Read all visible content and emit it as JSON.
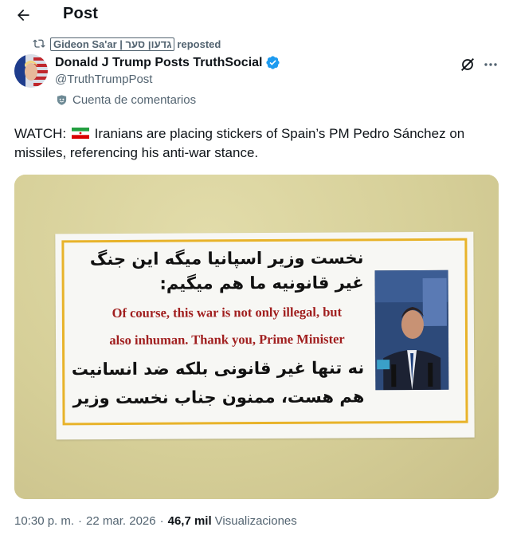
{
  "header": {
    "title": "Post"
  },
  "repost": {
    "reposter": "Gideon Sa'ar | גדעון סער",
    "suffix": "reposted"
  },
  "author": {
    "name": "Donald J Trump Posts TruthSocial",
    "handle": "@TruthTrumpPost",
    "community": "Cuenta de comentarios"
  },
  "post": {
    "text_prefix": "WATCH:",
    "text_body": "Iranians are placing stickers of Spain’s PM Pedro Sánchez on missiles, referencing his anti-war stance."
  },
  "sticker": {
    "fa_line1": "نخست وزیر اسپانیا میگه این جنگ",
    "fa_line2": "غیر قانونیه ما هم میگیم:",
    "en_line1": "Of course, this war is not only illegal, but",
    "en_line2": "also inhuman. Thank you, Prime Minister",
    "fa_line3": "نه تنها غیر قانونی بلکه ضد انسانیت",
    "fa_line4": "هم هست، ممنون جناب نخست وزیر"
  },
  "meta": {
    "time": "10:30 p. m.",
    "date": "22 mar. 2026",
    "views_count": "46,7 mil",
    "views_label": "Visualizaciones"
  },
  "colors": {
    "accent": "#1d9bf0",
    "secondary_text": "#536471",
    "sticker_border": "#e8b32a",
    "sticker_text_red": "#a01e1e"
  }
}
